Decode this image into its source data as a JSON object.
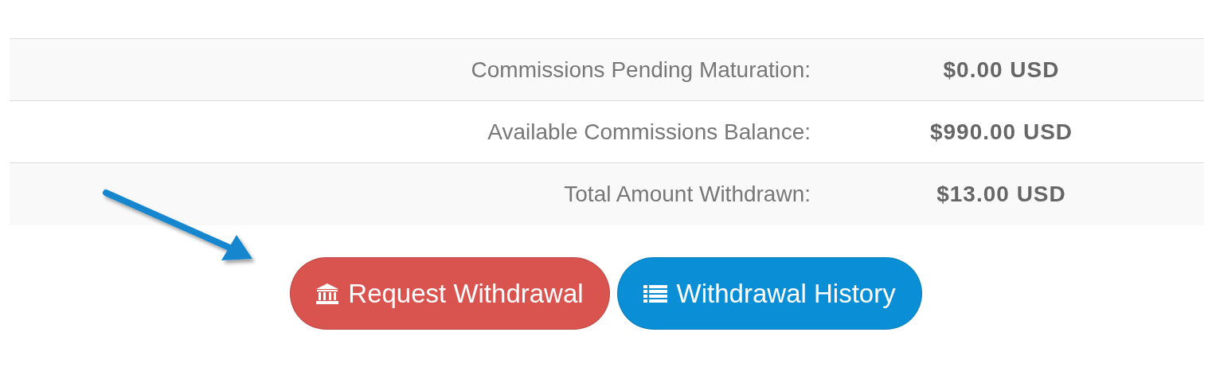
{
  "summary": {
    "rows": [
      {
        "label": "Commissions Pending Maturation:",
        "value": "$0.00 USD"
      },
      {
        "label": "Available Commissions Balance:",
        "value": "$990.00 USD"
      },
      {
        "label": "Total Amount Withdrawn:",
        "value": "$13.00 USD"
      }
    ]
  },
  "buttons": [
    {
      "label": "Request Withdrawal",
      "kind": "bank",
      "color": "#d9534f"
    },
    {
      "label": "Withdrawal History",
      "kind": "list",
      "color": "#0a8fd6"
    }
  ]
}
